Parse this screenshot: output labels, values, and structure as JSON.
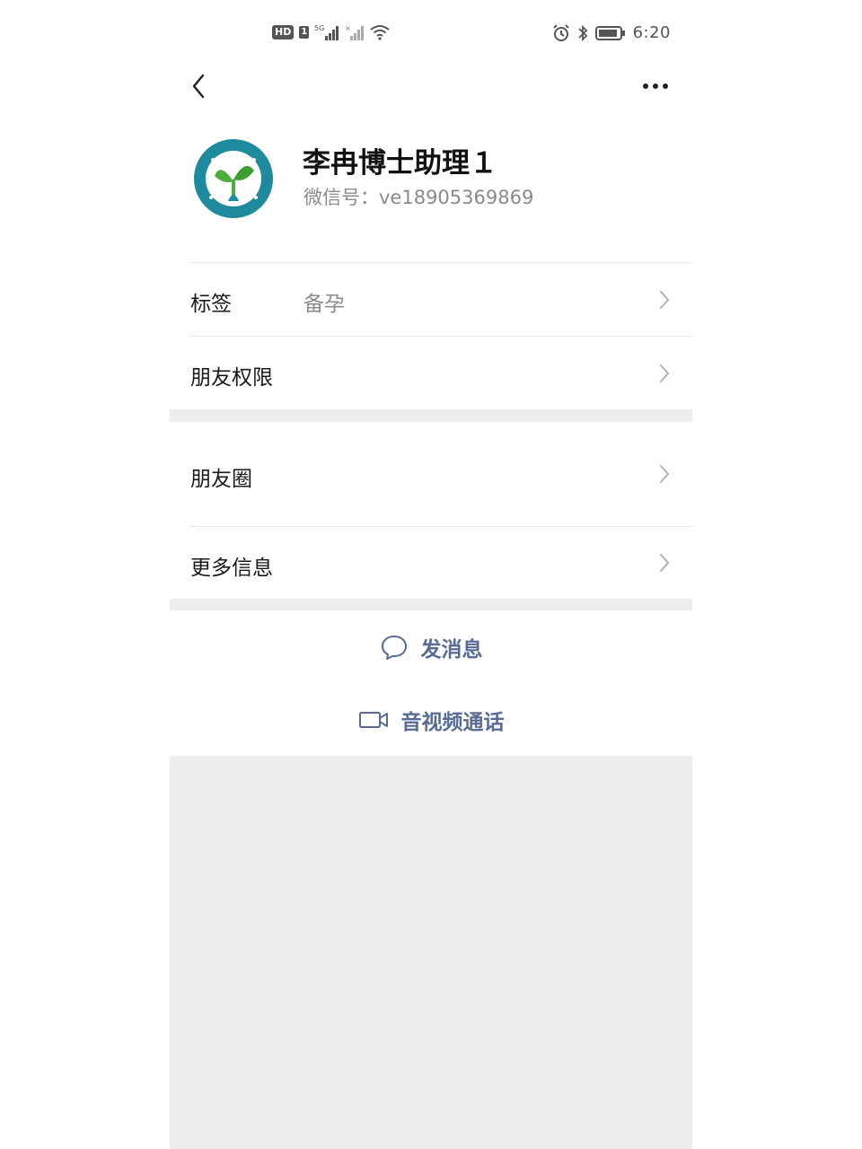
{
  "status_bar": {
    "hd": "HD",
    "sim": "1",
    "network": "5G",
    "time": "6:20"
  },
  "nav": {
    "back_icon": "chevron-left-icon",
    "more_icon": "more-dots-icon"
  },
  "profile": {
    "name": "李冉博士助理１",
    "wechat_id": "微信号：ve18905369869",
    "avatar_icon": "sprout-logo-avatar"
  },
  "rows": {
    "tag": {
      "label": "标签",
      "value": "备孕"
    },
    "friend_permission": {
      "label": "朋友权限"
    },
    "moments": {
      "label": "朋友圈"
    },
    "more_info": {
      "label": "更多信息"
    }
  },
  "actions": {
    "message": {
      "label": "发消息",
      "icon": "chat-bubble-icon"
    },
    "call": {
      "label": "音视频通话",
      "icon": "video-camera-icon"
    }
  },
  "colors": {
    "accent": "#576b95",
    "section_bg": "#ededed",
    "avatar_ring": "#1e8a9e",
    "leaf_green": "#4caf3c"
  }
}
